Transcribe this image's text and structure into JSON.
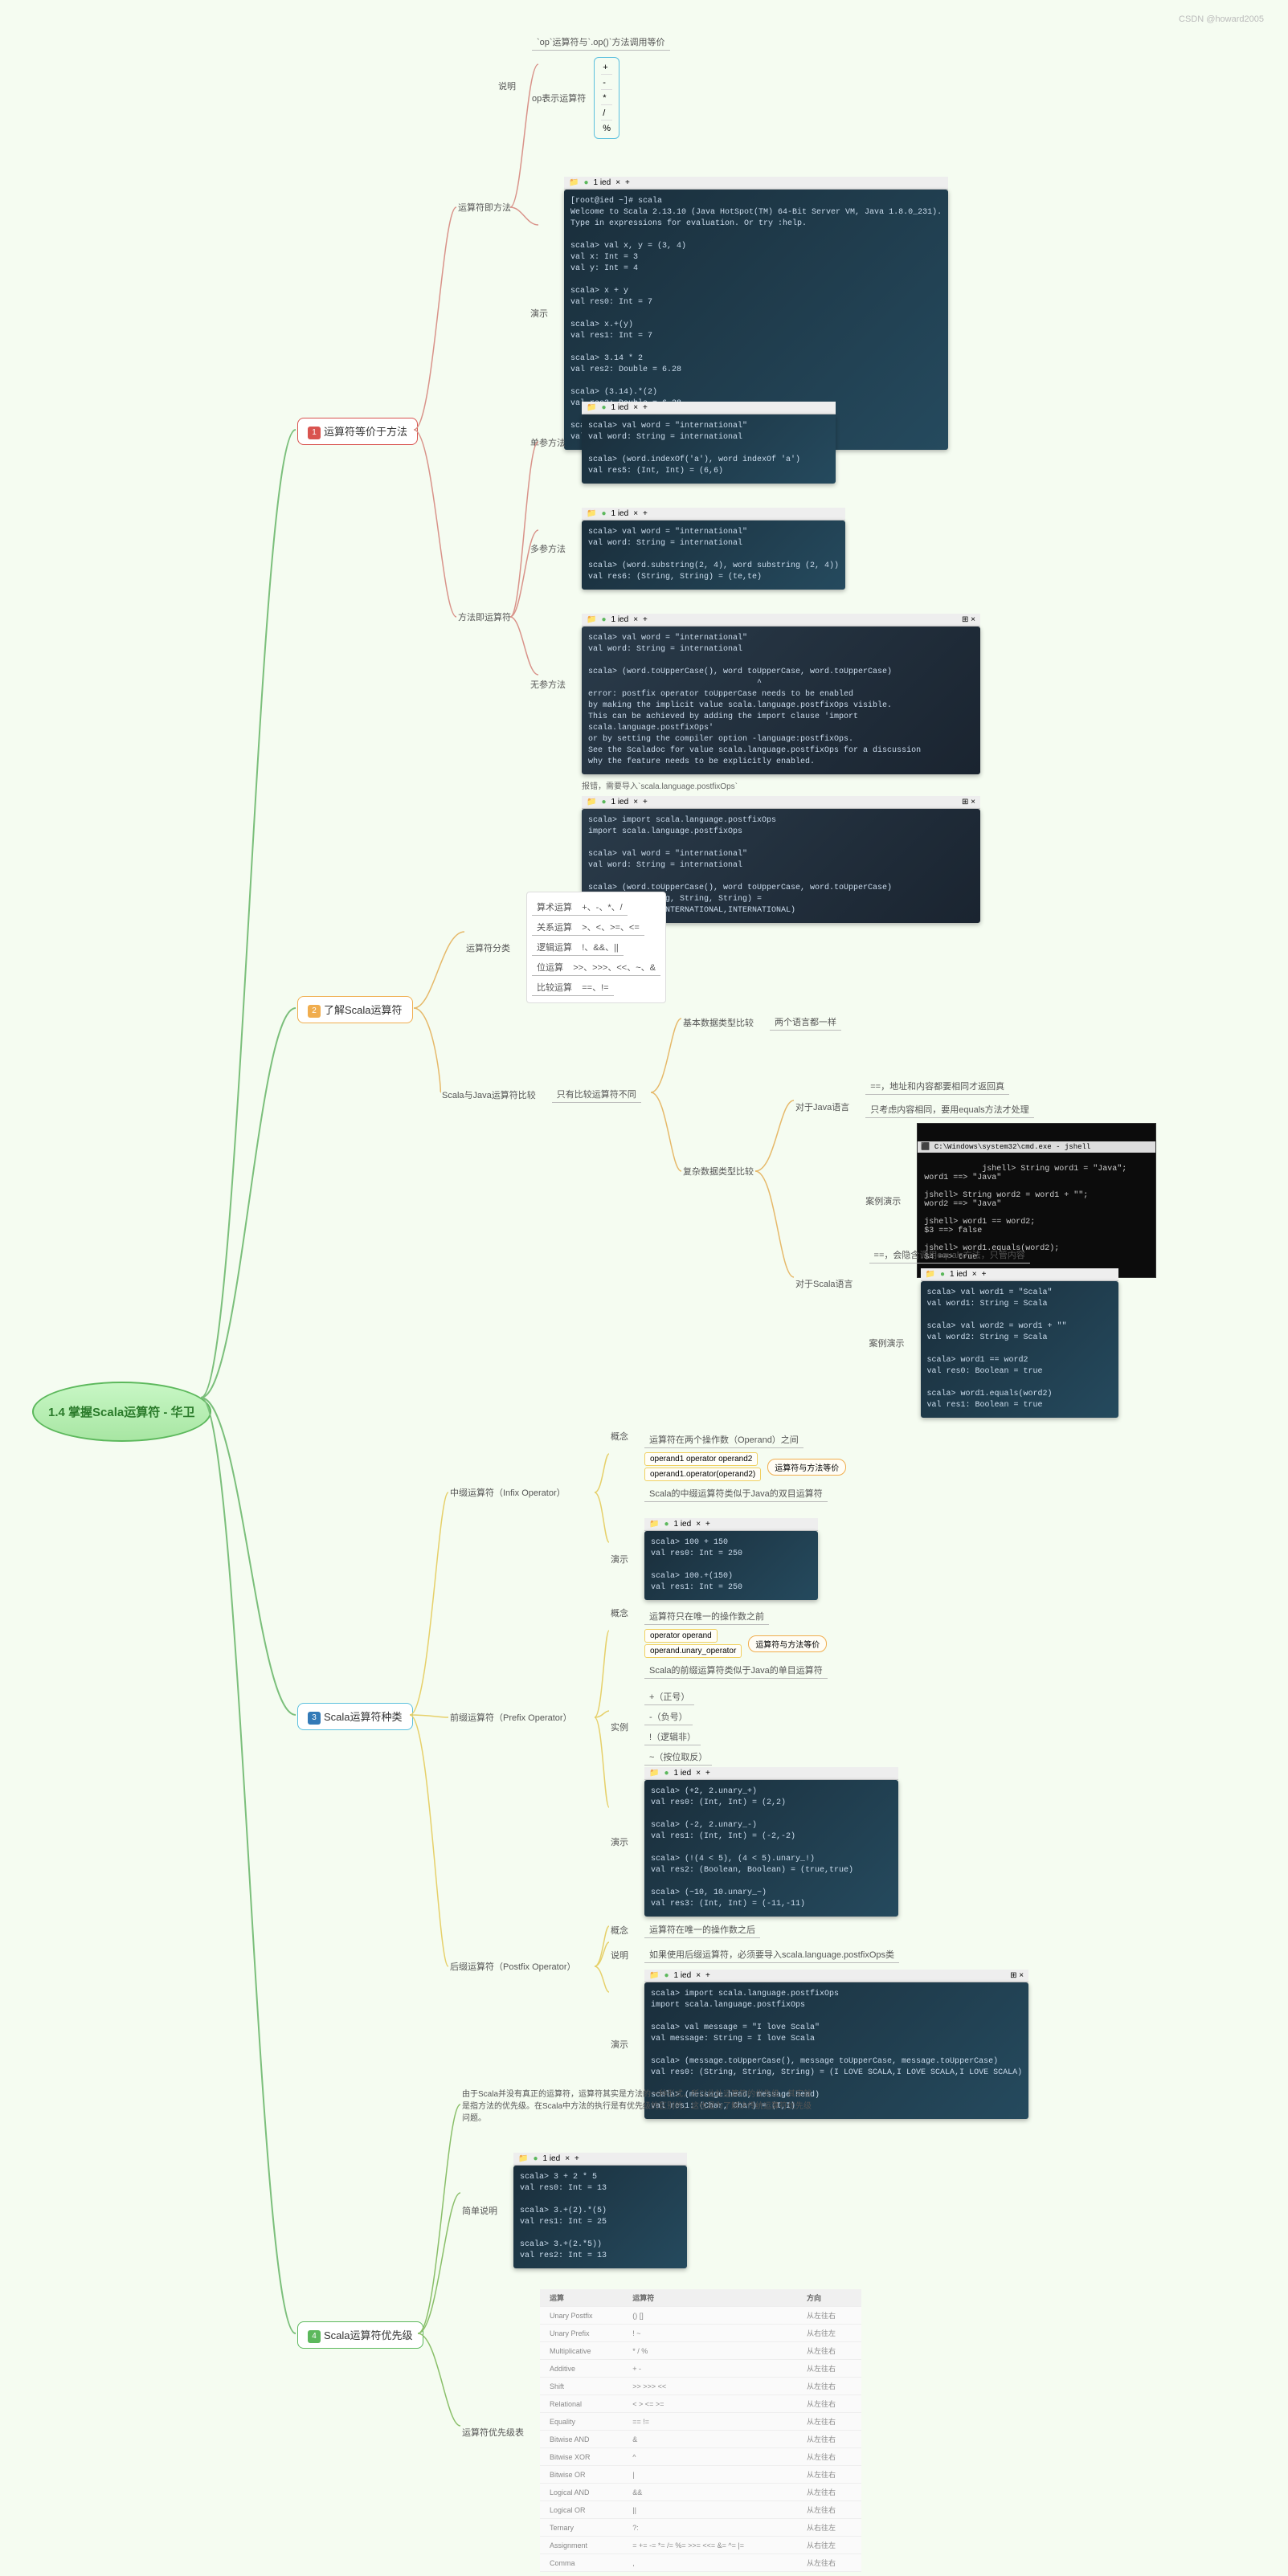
{
  "root": "1.4 掌握Scala运算符 - 华卫",
  "watermark": "CSDN @howard2005",
  "lvl1": {
    "a": "运算符等价于方法",
    "b": "了解Scala运算符",
    "c": "Scala运算符种类",
    "d": "Scala运算符优先级"
  },
  "sec1": {
    "op_method": "运算符即方法",
    "method_op": "方法即运算符",
    "explain": "说明",
    "demo": "演示",
    "explain_top": "`op`运算符与`.op()`方法调用等价",
    "op_label": "op表示运算符",
    "ops": [
      "+",
      "-",
      "*",
      "/",
      "%"
    ],
    "single": "单参方法",
    "multi": "多参方法",
    "noarg": "无参方法",
    "noarg_note": "报错，需要导入`scala.language.postfixOps`",
    "code_demo": "[root@ied ~]# scala\nWelcome to Scala 2.13.10 (Java HotSpot(TM) 64-Bit Server VM, Java 1.8.0_231).\nType in expressions for evaluation. Or try :help.\n\nscala> val x, y = (3, 4)\nval x: Int = 3\nval y: Int = 4\n\nscala> x + y\nval res0: Int = 7\n\nscala> x.+(y)\nval res1: Int = 7\n\nscala> 3.14 * 2\nval res2: Double = 6.28\n\nscala> (3.14).*(2)\nval res3: Double = 6.28\n\nscala> (1,2).swap\nval res4: (Int, Int) = (2,1)",
    "code_single": "scala> val word = \"international\"\nval word: String = international\n\nscala> (word.indexOf('a'), word indexOf 'a')\nval res5: (Int, Int) = (6,6)",
    "code_multi": "scala> val word = \"international\"\nval word: String = international\n\nscala> (word.substring(2, 4), word substring (2, 4))\nval res6: (String, String) = (te,te)",
    "code_noarg1": "scala> val word = \"international\"\nval word: String = international\n\nscala> (word.toUpperCase(), word toUpperCase, word.toUpperCase)\n                                   ^\nerror: postfix operator toUpperCase needs to be enabled\nby making the implicit value scala.language.postfixOps visible.\nThis can be achieved by adding the import clause 'import scala.language.postfixOps'\nor by setting the compiler option -language:postfixOps.\nSee the Scaladoc for value scala.language.postfixOps for a discussion\nwhy the feature needs to be explicitly enabled.",
    "code_noarg2": "scala> import scala.language.postfixOps\nimport scala.language.postfixOps\n\nscala> val word = \"international\"\nval word: String = international\n\nscala> (word.toUpperCase(), word toUpperCase, word.toUpperCase)\nval res0: (String, String, String) = (INTERNATIONAL,INTERNATIONAL,INTERNATIONAL)"
  },
  "sec2": {
    "cat": "运算符分类",
    "cmp": "Scala与Java运算符比较",
    "cmp_note": "只有比较运算符不同",
    "rows": [
      {
        "k": "算术运算",
        "v": "+、-、*、/"
      },
      {
        "k": "关系运算",
        "v": ">、<、>=、<="
      },
      {
        "k": "逻辑运算",
        "v": "!、&&、||"
      },
      {
        "k": "位运算",
        "v": ">>、>>>、<<、~、&"
      },
      {
        "k": "比较运算",
        "v": "==、!="
      }
    ],
    "basic": "基本数据类型比较",
    "basic_note": "两个语言都一样",
    "complex": "复杂数据类型比较",
    "java_lang": "对于Java语言",
    "scala_lang": "对于Scala语言",
    "java_n1": "==，地址和内容都要相同才返回真",
    "java_n2": "只考虑内容相同，要用equals方法才处理",
    "java_demo": "案例演示",
    "scala_n1": "==，会隐含调用equals方法，只管内容",
    "scala_demo": "案例演示",
    "cmd_title": "C:\\Windows\\system32\\cmd.exe - jshell",
    "cmd_body": "jshell> String word1 = \"Java\";\nword1 ==> \"Java\"\n\njshell> String word2 = word1 + \"\";\nword2 ==> \"Java\"\n\njshell> word1 == word2;\n$3 ==> false\n\njshell> word1.equals(word2);\n$4 ==> true",
    "scala_code": "scala> val word1 = \"Scala\"\nval word1: String = Scala\n\nscala> val word2 = word1 + \"\"\nval word2: String = Scala\n\nscala> word1 == word2\nval res0: Boolean = true\n\nscala> word1.equals(word2)\nval res1: Boolean = true"
  },
  "sec3": {
    "infix": "中缀运算符（Infix Operator）",
    "prefix": "前缀运算符（Prefix Operator）",
    "postfix": "后缀运算符（Postfix Operator）",
    "concept": "概念",
    "demo": "演示",
    "example": "实例",
    "explain": "说明",
    "infix_c1": "运算符在两个操作数（Operand）之间",
    "infix_c2": "operand1 operator operand2",
    "infix_c3": "operand1.operator(operand2)",
    "infix_c4": "Scala的中缀运算符类似于Java的双目运算符",
    "infix_pill": "运算符与方法等价",
    "infix_code": "scala> 100 + 150\nval res0: Int = 250\n\nscala> 100.+(150)\nval res1: Int = 250",
    "prefix_c1": "运算符只在唯一的操作数之前",
    "prefix_c2": "operator operand",
    "prefix_c3": "operand.unary_operator",
    "prefix_c4": "Scala的前缀运算符类似于Java的单目运算符",
    "prefix_pill": "运算符与方法等价",
    "prefix_ex": [
      "+（正号）",
      "-（负号）",
      "!（逻辑非）",
      "~（按位取反）"
    ],
    "prefix_code": "scala> (+2, 2.unary_+)\nval res0: (Int, Int) = (2,2)\n\nscala> (-2, 2.unary_-)\nval res1: (Int, Int) = (-2,-2)\n\nscala> (!(4 < 5), (4 < 5).unary_!)\nval res2: (Boolean, Boolean) = (true,true)\n\nscala> (~10, 10.unary_~)\nval res3: (Int, Int) = (-11,-11)",
    "postfix_c": "运算符在唯一的操作数之后",
    "postfix_note": "如果使用后缀运算符，必须要导入scala.language.postfixOps类",
    "postfix_code": "scala> import scala.language.postfixOps\nimport scala.language.postfixOps\n\nscala> val message = \"I love Scala\"\nval message: String = I love Scala\n\nscala> (message.toUpperCase(), message toUpperCase, message.toUpperCase)\nval res0: (String, String, String) = (I LOVE SCALA,I LOVE SCALA,I LOVE SCALA)\n\nscala> (message.head, message head)\nval res1: (Char, Char) = (I,I)"
  },
  "sec4": {
    "desc": "由于Scala并没有真正的运算符，运算符其实是方法的一种形式，所以此处运算符的优先级，其实就是指方法的优先级。在Scala中方法的执行是有优先级的区别的，这也是为了解决传统运算符优先级问题。",
    "simple": "简单说明",
    "table": "运算符优先级表",
    "code": "scala> 3 + 2 * 5\nval res0: Int = 13\n\nscala> 3.+(2).*(5)\nval res1: Int = 25\n\nscala> 3.+(2.*5))\nval res2: Int = 13",
    "headers": [
      "运算",
      "运算符",
      "方向"
    ],
    "rows": [
      [
        "Unary Postfix",
        "() []",
        "从左往右"
      ],
      [
        "Unary Prefix",
        "! ~",
        "从右往左"
      ],
      [
        "Multiplicative",
        "* / %",
        "从左往右"
      ],
      [
        "Additive",
        "+ -",
        "从左往右"
      ],
      [
        "Shift",
        ">> >>> <<",
        "从左往右"
      ],
      [
        "Relational",
        "< > <= >=",
        "从左往右"
      ],
      [
        "Equality",
        "== !=",
        "从左往右"
      ],
      [
        "Bitwise AND",
        "&",
        "从左往右"
      ],
      [
        "Bitwise XOR",
        "^",
        "从左往右"
      ],
      [
        "Bitwise OR",
        "|",
        "从左往右"
      ],
      [
        "Logical AND",
        "&&",
        "从左往右"
      ],
      [
        "Logical OR",
        "||",
        "从左往右"
      ],
      [
        "Ternary",
        "?:",
        "从右往左"
      ],
      [
        "Assignment",
        "= += -= *= /= %= >>= <<= &= ^= |=",
        "从右往左"
      ],
      [
        "Comma",
        ",",
        "从左往右"
      ]
    ]
  },
  "tab_label": "1 ied"
}
